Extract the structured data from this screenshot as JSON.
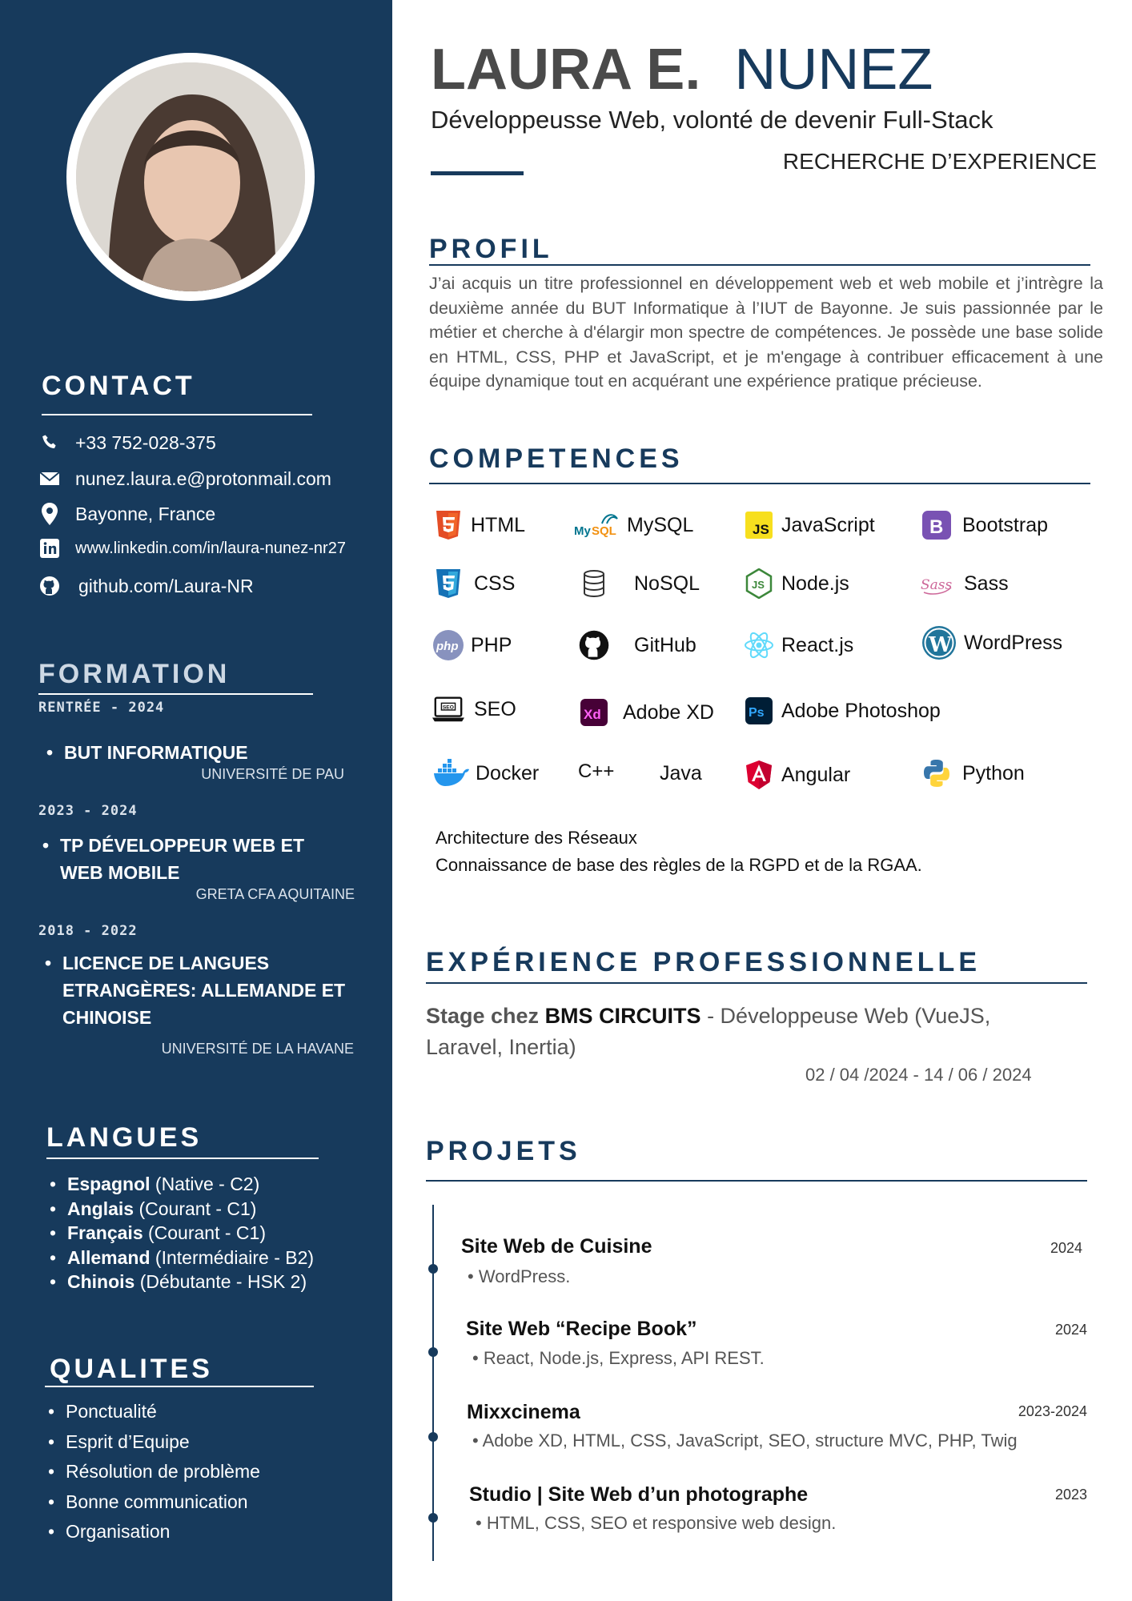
{
  "name": {
    "first": "LAURA E.",
    "last": "NUNEZ"
  },
  "subtitle": "Développeusse Web, volonté de devenir Full-Stack",
  "seeking": "RECHERCHE D’EXPERIENCE",
  "contact": {
    "heading": "CONTACT",
    "phone": "+33 752-028-375",
    "email": "nunez.laura.e@protonmail.com",
    "location": "Bayonne, France",
    "linkedin": "www.linkedin.com/in/laura-nunez-nr27",
    "github": "github.com/Laura-NR"
  },
  "formation": {
    "heading": "FORMATION",
    "items": [
      {
        "period": "RENTRÉE - 2024",
        "degree_line1": "BUT INFORMATIQUE",
        "degree_line2": "",
        "degree_line3": "",
        "school": "UNIVERSITÉ DE PAU"
      },
      {
        "period": "2023 - 2024",
        "degree_line1": "TP DÉVELOPPEUR WEB ET",
        "degree_line2": "WEB MOBILE",
        "degree_line3": "",
        "school": "GRETA CFA AQUITAINE"
      },
      {
        "period": "2018 - 2022",
        "degree_line1": "LICENCE DE LANGUES",
        "degree_line2": "ETRANGÈRES: ALLEMANDE ET",
        "degree_line3": "CHINOISE",
        "school": "UNIVERSITÉ DE LA HAVANE"
      }
    ]
  },
  "langues": {
    "heading": "LANGUES",
    "items": [
      {
        "lang": "Espagnol",
        "level": " (Native - C2)"
      },
      {
        "lang": "Anglais",
        "level": " (Courant - C1)"
      },
      {
        "lang": "Français",
        "level": " (Courant - C1)"
      },
      {
        "lang": "Allemand",
        "level": " (Intermédiaire - B2)"
      },
      {
        "lang": "Chinois",
        "level": " (Débutante - HSK 2)"
      }
    ]
  },
  "qualites": {
    "heading": "QUALITES",
    "items": [
      "Ponctualité",
      "Esprit d’Equipe",
      "Résolution de problème",
      "Bonne communication",
      "Organisation"
    ]
  },
  "profil": {
    "heading": "PROFIL",
    "text": "J’ai acquis un titre professionnel en développement web et web mobile et j’intrègre la deuxième année du BUT Informatique à l’IUT de Bayonne. Je suis passionnée par le métier et cherche à d'élargir mon spectre de compétences. Je possède une base solide en HTML, CSS, PHP et JavaScript, et je m'engage à contribuer efficacement à une équipe dynamique tout en acquérant une expérience pratique précieuse."
  },
  "competences": {
    "heading": "COMPETENCES",
    "skills": [
      {
        "label": "HTML",
        "icon": "html5-icon",
        "color": "#e44d26"
      },
      {
        "label": "MySQL",
        "icon": "mysql-icon",
        "color": "#00758f"
      },
      {
        "label": "JavaScript",
        "icon": "javascript-icon",
        "color": "#f7df1e"
      },
      {
        "label": "Bootstrap",
        "icon": "bootstrap-icon",
        "color": "#7952b3"
      },
      {
        "label": "CSS",
        "icon": "css3-icon",
        "color": "#2965f1"
      },
      {
        "label": "NoSQL",
        "icon": "database-icon",
        "color": "#333333"
      },
      {
        "label": "Node.js",
        "icon": "nodejs-icon",
        "color": "#3c873a"
      },
      {
        "label": "Sass",
        "icon": "sass-icon",
        "color": "#cd6799"
      },
      {
        "label": "PHP",
        "icon": "php-icon",
        "color": "#8892be"
      },
      {
        "label": "GitHub",
        "icon": "github-icon",
        "color": "#111111"
      },
      {
        "label": "React.js",
        "icon": "react-icon",
        "color": "#61dafb"
      },
      {
        "label": "WordPress",
        "icon": "wordpress-icon",
        "color": "#21759b"
      },
      {
        "label": "SEO",
        "icon": "seo-laptop-icon",
        "color": "#111111"
      },
      {
        "label": "Adobe XD",
        "icon": "adobe-xd-icon",
        "color": "#ff26be"
      },
      {
        "label": "Adobe Photoshop",
        "icon": "photoshop-icon",
        "color": "#31a8ff"
      },
      {
        "label": "Docker",
        "icon": "docker-icon",
        "color": "#2496ed"
      },
      {
        "label": "C++",
        "icon": "",
        "color": ""
      },
      {
        "label": "Java",
        "icon": "",
        "color": ""
      },
      {
        "label": "Angular",
        "icon": "angular-icon",
        "color": "#dd0031"
      },
      {
        "label": "Python",
        "icon": "python-icon",
        "color": "#3776ab"
      }
    ],
    "extra1": "Architecture des Réseaux",
    "extra2": "Connaissance de base des règles de la RGPD et de la RGAA."
  },
  "experience": {
    "heading": "EXPÉRIENCE PROFESSIONNELLE",
    "prefix": "Stage chez ",
    "company": "BMS CIRCUITS",
    "role_line1": " - Développeuse Web (VueJS,",
    "role_line2": "Laravel, Inertia)",
    "dates": "02 / 04 /2024 - 14 / 06 / 2024"
  },
  "projets": {
    "heading": "PROJETS",
    "items": [
      {
        "title": "Site Web de Cuisine",
        "year": "2024",
        "desc": "WordPress."
      },
      {
        "title": "Site Web “Recipe Book”",
        "year": "2024",
        "desc": "React, Node.js, Express, API REST."
      },
      {
        "title": "Mixxcinema",
        "year": "2023-2024",
        "desc": "Adobe XD, HTML, CSS, JavaScript, SEO, structure MVC, PHP, Twig"
      },
      {
        "title": "Studio | Site Web d’un photographe",
        "year": "2023",
        "desc": "HTML, CSS, SEO et responsive web design."
      }
    ]
  }
}
